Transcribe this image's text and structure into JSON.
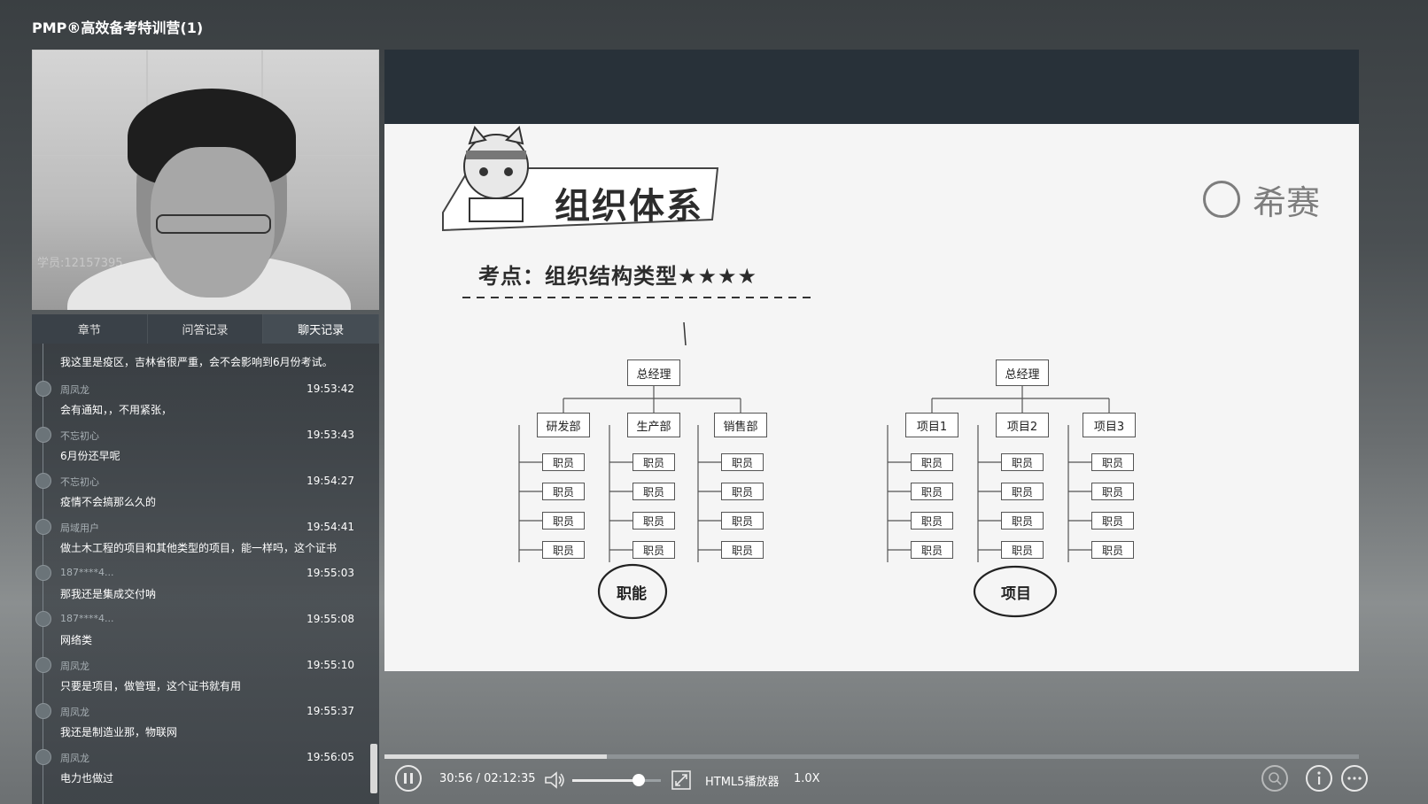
{
  "window": {
    "title": "PMP®高效备考特训营(1)"
  },
  "webcam": {
    "watermark": "学员:12157395"
  },
  "tabs": [
    {
      "label": "章节",
      "active": false
    },
    {
      "label": "问答记录",
      "active": false
    },
    {
      "label": "聊天记录",
      "active": true
    }
  ],
  "chat": {
    "top_message": "我这里是疫区，吉林省很严重，会不会影响到6月份考试。",
    "messages": [
      {
        "user": "周凤龙",
        "time": "19:53:42",
        "text": "会有通知，，不用紧张，"
      },
      {
        "user": "不忘初心",
        "time": "19:53:43",
        "text": "6月份还早呢"
      },
      {
        "user": "不忘初心",
        "time": "19:54:27",
        "text": "疫情不会搞那么久的"
      },
      {
        "user": "局域用户",
        "time": "19:54:41",
        "text": "做土木工程的项目和其他类型的项目，能一样吗，这个证书"
      },
      {
        "user": "187****4...",
        "time": "19:55:03",
        "text": "那我还是集成交付呐"
      },
      {
        "user": "187****4...",
        "time": "19:55:08",
        "text": "网络类"
      },
      {
        "user": "周凤龙",
        "time": "19:55:10",
        "text": "只要是项目，做管理，这个证书就有用"
      },
      {
        "user": "周凤龙",
        "time": "19:55:37",
        "text": "我还是制造业那，物联网"
      },
      {
        "user": "周凤龙",
        "time": "19:56:05",
        "text": "电力也做过"
      }
    ]
  },
  "slide": {
    "title": "组织体系",
    "subtitle": "考点：组织结构类型★★★★",
    "brand": "希赛",
    "functional": {
      "root": "总经理",
      "departments": [
        "研发部",
        "生产部",
        "销售部"
      ],
      "staff": "职员",
      "label": "职能"
    },
    "project": {
      "root": "总经理",
      "departments": [
        "项目1",
        "项目2",
        "项目3"
      ],
      "staff": "职员",
      "label": "项目"
    }
  },
  "player": {
    "time": "30:56 / 02:12:35",
    "player_name": "HTML5播放器",
    "speed": "1.0X",
    "progress": 0.228,
    "volume": 0.75,
    "play_icon": "pause-icon",
    "volume_icon": "speaker-icon",
    "fullscreen_icon": "fullscreen-icon"
  }
}
